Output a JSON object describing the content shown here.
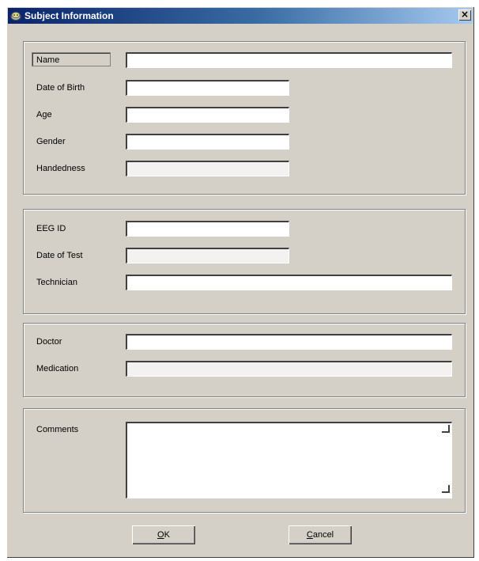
{
  "window": {
    "title": "Subject Information",
    "close_label": "×"
  },
  "sections": {
    "subject": {
      "name_label": "Name",
      "dob_label": "Date of Birth",
      "age_label": "Age",
      "gender_label": "Gender",
      "handedness_label": "Handedness"
    },
    "test": {
      "eeg_id_label": "EEG ID",
      "date_of_test_label": "Date of Test",
      "technician_label": "Technician"
    },
    "clinical": {
      "doctor_label": "Doctor",
      "medication_label": "Medication"
    },
    "notes": {
      "comments_label": "Comments"
    }
  },
  "fields": {
    "name": "",
    "dob": "",
    "age": "",
    "gender": "",
    "handedness": "",
    "eeg_id": "",
    "date_of_test": "",
    "technician": "",
    "doctor": "",
    "medication": "",
    "comments": ""
  },
  "buttons": {
    "ok_mnemonic": "O",
    "ok_rest": "K",
    "cancel_mnemonic": "C",
    "cancel_rest": "ancel"
  },
  "colors": {
    "dialog_background": "#d4d0c8",
    "titlebar_start": "#0a246a",
    "titlebar_end": "#a6caf0"
  },
  "icons": {
    "app": "app-icon",
    "close": "close-icon",
    "resize": "resize-grip-icon"
  }
}
